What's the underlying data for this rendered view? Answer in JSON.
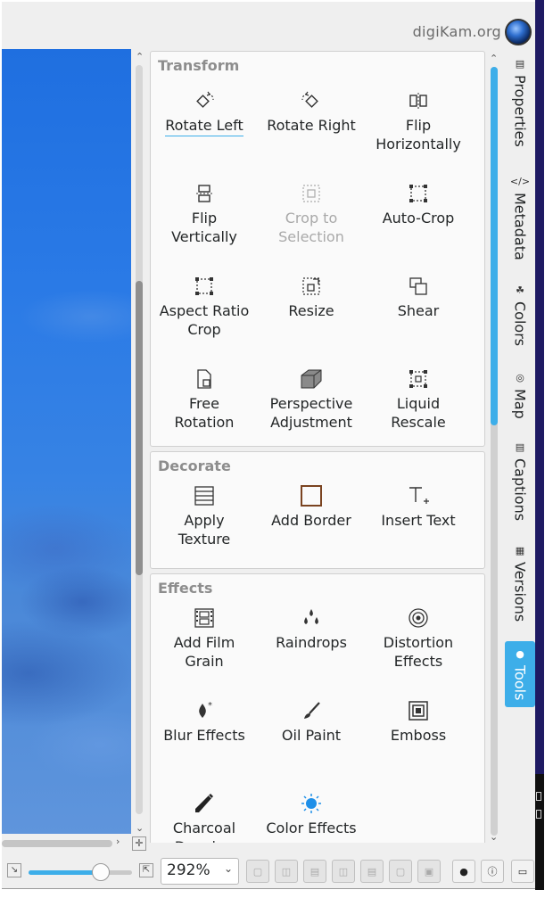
{
  "header": {
    "brand": "digiKam.org"
  },
  "groups": {
    "transform": {
      "title": "Transform",
      "tools": [
        {
          "label": "Rotate Left",
          "icon": "rotate-left-icon"
        },
        {
          "label": "Rotate Right",
          "icon": "rotate-right-icon"
        },
        {
          "label": "Flip\nHorizontally",
          "icon": "flip-horizontal-icon"
        },
        {
          "label": "Flip\nVertically",
          "icon": "flip-vertical-icon"
        },
        {
          "label": "Crop to\nSelection",
          "icon": "crop-selection-icon"
        },
        {
          "label": "Auto-Crop",
          "icon": "auto-crop-icon"
        },
        {
          "label": "Aspect Ratio\nCrop",
          "icon": "aspect-ratio-crop-icon"
        },
        {
          "label": "Resize",
          "icon": "resize-icon"
        },
        {
          "label": "Shear",
          "icon": "shear-icon"
        },
        {
          "label": "Free\nRotation",
          "icon": "free-rotation-icon"
        },
        {
          "label": "Perspective\nAdjustment",
          "icon": "perspective-icon"
        },
        {
          "label": "Liquid\nRescale",
          "icon": "liquid-rescale-icon"
        }
      ]
    },
    "decorate": {
      "title": "Decorate",
      "tools": [
        {
          "label": "Apply\nTexture",
          "icon": "texture-icon"
        },
        {
          "label": "Add Border",
          "icon": "border-icon"
        },
        {
          "label": "Insert Text",
          "icon": "insert-text-icon"
        }
      ]
    },
    "effects": {
      "title": "Effects",
      "tools": [
        {
          "label": "Add Film\nGrain",
          "icon": "film-grain-icon"
        },
        {
          "label": "Raindrops",
          "icon": "raindrops-icon"
        },
        {
          "label": "Distortion\nEffects",
          "icon": "distortion-icon"
        },
        {
          "label": "Blur Effects",
          "icon": "blur-icon"
        },
        {
          "label": "Oil Paint",
          "icon": "oil-paint-icon"
        },
        {
          "label": "Emboss",
          "icon": "emboss-icon"
        },
        {
          "label": "Charcoal\nDrawing",
          "icon": "charcoal-icon"
        },
        {
          "label": "Color Effects",
          "icon": "color-effects-icon"
        }
      ]
    }
  },
  "sidebar_tabs": [
    {
      "label": "Properties",
      "icon": "properties-icon"
    },
    {
      "label": "Metadata",
      "icon": "metadata-icon"
    },
    {
      "label": "Colors",
      "icon": "colors-icon"
    },
    {
      "label": "Map",
      "icon": "map-icon"
    },
    {
      "label": "Captions",
      "icon": "captions-icon"
    },
    {
      "label": "Versions",
      "icon": "versions-icon"
    },
    {
      "label": "Tools",
      "icon": "tools-icon",
      "active": true
    }
  ],
  "statusbar": {
    "zoom_value": "292%",
    "zoom_slider_fraction": 0.7
  },
  "colors": {
    "accent": "#3daee9",
    "sky": "#2a7ae6"
  }
}
